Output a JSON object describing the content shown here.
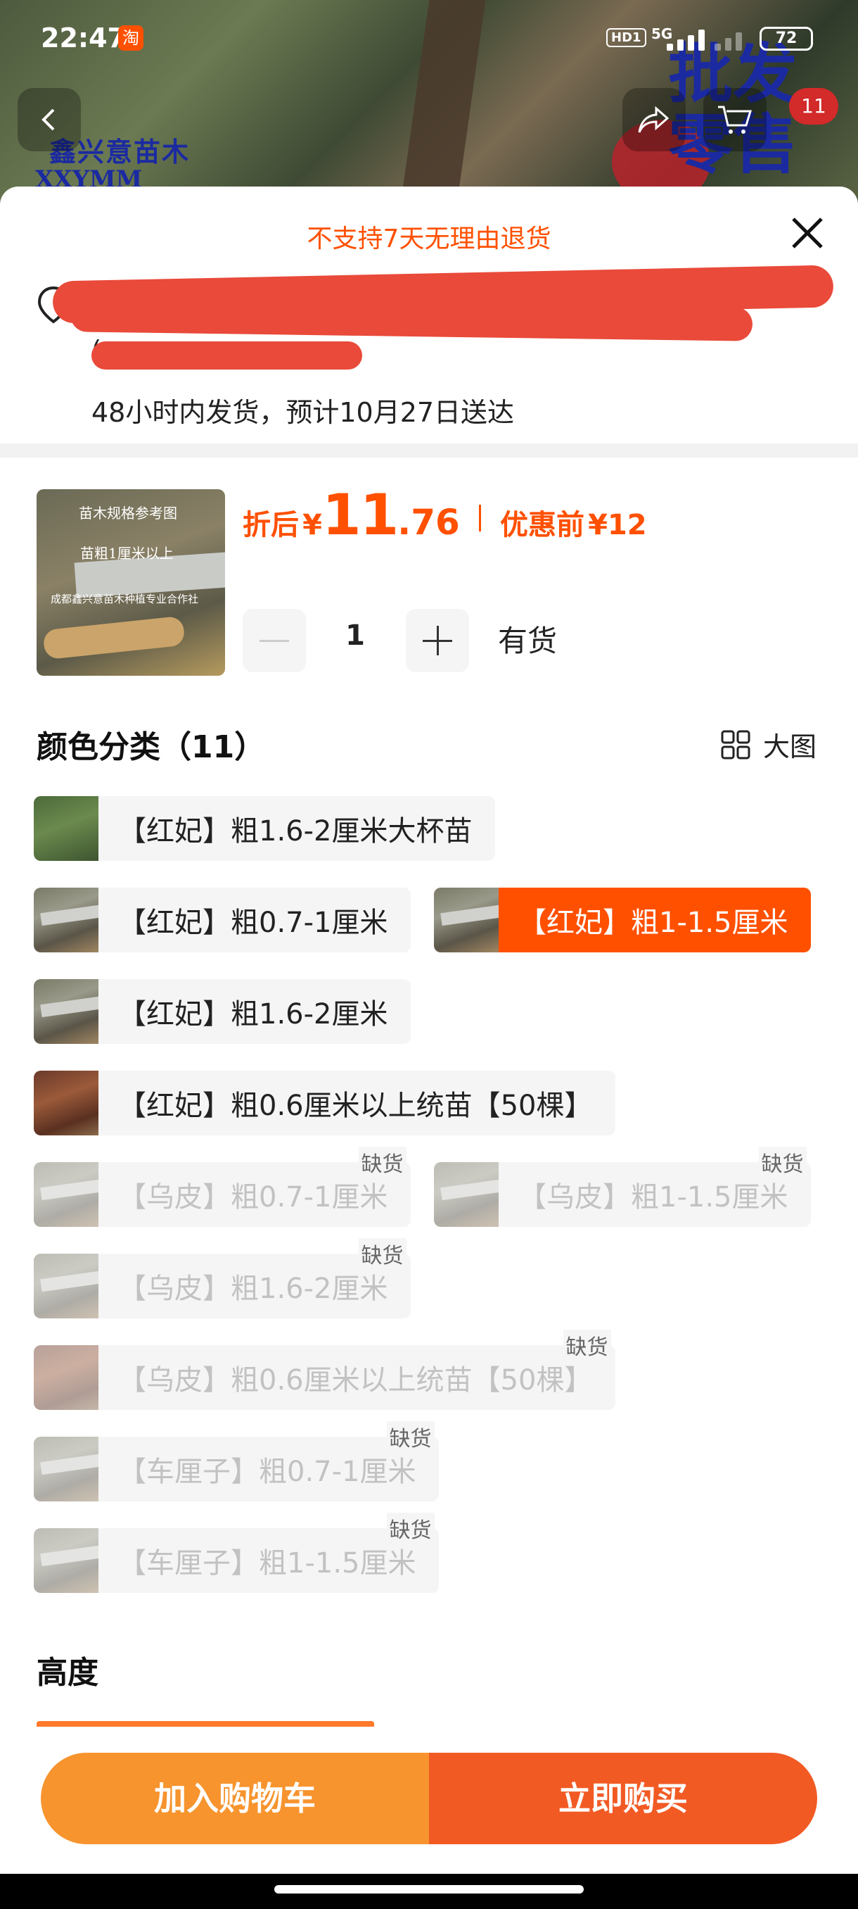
{
  "status_bar": {
    "time": "22:47",
    "app_badge": "淘",
    "hd_label": "HD1",
    "network": "5G",
    "battery": "72"
  },
  "background": {
    "brand_name": "鑫兴意苗木",
    "brand_sub": "XXYMM",
    "brand_tagline_line1": "批发",
    "brand_tagline_line2": "零售"
  },
  "cart_count": "11",
  "sheet": {
    "notice": "不支持7天无理由退货",
    "address_tail": "(",
    "delivery": "48小时内发货，预计10月27日送达"
  },
  "product": {
    "thumb_text1": "苗木规格参考图",
    "thumb_text2": "苗粗1厘米以上",
    "thumb_text3": "成都鑫兴意苗木种植专业合作社",
    "after_label": "折后",
    "currency": "¥",
    "price_int": "11",
    "price_dec": ".76",
    "before_label": "优惠前",
    "before_price": "¥12",
    "quantity": "1",
    "stock": "有货"
  },
  "color_section": {
    "title": "颜色分类（11）",
    "bigview_label": "大图",
    "out_of_stock_label": "缺货",
    "options": [
      {
        "label": "【红妃】粗1.6-2厘米大杯苗",
        "state": "normal"
      },
      {
        "label": "【红妃】粗0.7-1厘米",
        "state": "normal"
      },
      {
        "label": "【红妃】粗1-1.5厘米",
        "state": "selected"
      },
      {
        "label": "【红妃】粗1.6-2厘米",
        "state": "normal"
      },
      {
        "label": "【红妃】粗0.6厘米以上统苗【50棵】",
        "state": "normal"
      },
      {
        "label": "【乌皮】粗0.7-1厘米",
        "state": "disabled"
      },
      {
        "label": "【乌皮】粗1-1.5厘米",
        "state": "disabled"
      },
      {
        "label": "【乌皮】粗1.6-2厘米",
        "state": "disabled"
      },
      {
        "label": "【乌皮】粗0.6厘米以上统苗【50棵】",
        "state": "disabled"
      },
      {
        "label": "【车厘子】粗0.7-1厘米",
        "state": "disabled"
      },
      {
        "label": "【车厘子】粗1-1.5厘米",
        "state": "disabled"
      }
    ]
  },
  "height_section": {
    "title": "高度"
  },
  "actions": {
    "add_to_cart": "加入购物车",
    "buy_now": "立即购买"
  },
  "colors": {
    "accent": "#ff5000",
    "cart_button": "#f7942e",
    "buy_button": "#f25a24",
    "option_bg": "#f5f5f5"
  }
}
